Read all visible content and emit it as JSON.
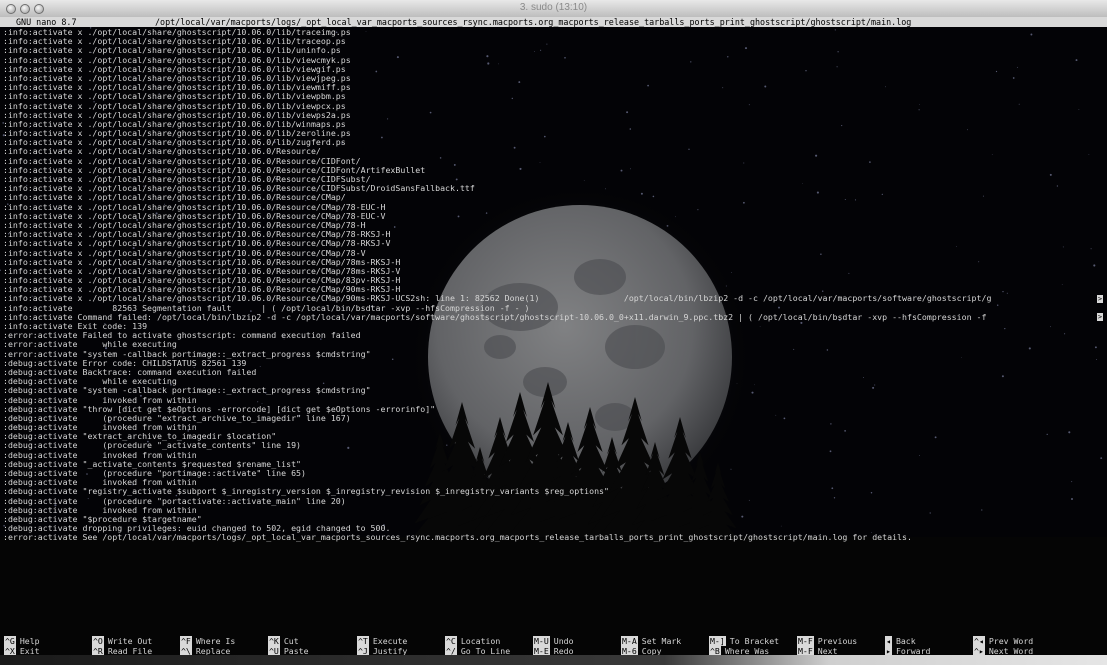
{
  "window": {
    "title": "3. sudo (13:10)"
  },
  "nano": {
    "version": "GNU nano 8.7",
    "file_path": "/opt/local/var/macports/logs/_opt_local_var_macports_sources_rsync.macports.org_macports_release_tarballs_ports_print_ghostscript/ghostscript/main.log"
  },
  "log_lines": [
    ":info:activate x ./opt/local/share/ghostscript/10.06.0/lib/traceimg.ps",
    ":info:activate x ./opt/local/share/ghostscript/10.06.0/lib/traceop.ps",
    ":info:activate x ./opt/local/share/ghostscript/10.06.0/lib/uninfo.ps",
    ":info:activate x ./opt/local/share/ghostscript/10.06.0/lib/viewcmyk.ps",
    ":info:activate x ./opt/local/share/ghostscript/10.06.0/lib/viewgif.ps",
    ":info:activate x ./opt/local/share/ghostscript/10.06.0/lib/viewjpeg.ps",
    ":info:activate x ./opt/local/share/ghostscript/10.06.0/lib/viewmiff.ps",
    ":info:activate x ./opt/local/share/ghostscript/10.06.0/lib/viewpbm.ps",
    ":info:activate x ./opt/local/share/ghostscript/10.06.0/lib/viewpcx.ps",
    ":info:activate x ./opt/local/share/ghostscript/10.06.0/lib/viewps2a.ps",
    ":info:activate x ./opt/local/share/ghostscript/10.06.0/lib/winmaps.ps",
    ":info:activate x ./opt/local/share/ghostscript/10.06.0/lib/zeroline.ps",
    ":info:activate x ./opt/local/share/ghostscript/10.06.0/lib/zugferd.ps",
    ":info:activate x ./opt/local/share/ghostscript/10.06.0/Resource/",
    ":info:activate x ./opt/local/share/ghostscript/10.06.0/Resource/CIDFont/",
    ":info:activate x ./opt/local/share/ghostscript/10.06.0/Resource/CIDFont/ArtifexBullet",
    ":info:activate x ./opt/local/share/ghostscript/10.06.0/Resource/CIDFSubst/",
    ":info:activate x ./opt/local/share/ghostscript/10.06.0/Resource/CIDFSubst/DroidSansFallback.ttf",
    ":info:activate x ./opt/local/share/ghostscript/10.06.0/Resource/CMap/",
    ":info:activate x ./opt/local/share/ghostscript/10.06.0/Resource/CMap/78-EUC-H",
    ":info:activate x ./opt/local/share/ghostscript/10.06.0/Resource/CMap/78-EUC-V",
    ":info:activate x ./opt/local/share/ghostscript/10.06.0/Resource/CMap/78-H",
    ":info:activate x ./opt/local/share/ghostscript/10.06.0/Resource/CMap/78-RKSJ-H",
    ":info:activate x ./opt/local/share/ghostscript/10.06.0/Resource/CMap/78-RKSJ-V",
    ":info:activate x ./opt/local/share/ghostscript/10.06.0/Resource/CMap/78-V",
    ":info:activate x ./opt/local/share/ghostscript/10.06.0/Resource/CMap/78ms-RKSJ-H",
    ":info:activate x ./opt/local/share/ghostscript/10.06.0/Resource/CMap/78ms-RKSJ-V",
    ":info:activate x ./opt/local/share/ghostscript/10.06.0/Resource/CMap/83pv-RKSJ-H",
    ":info:activate x ./opt/local/share/ghostscript/10.06.0/Resource/CMap/90ms-RKSJ-H",
    ":info:activate x ./opt/local/share/ghostscript/10.06.0/Resource/CMap/90ms-RKSJ-UCS2sh: line 1: 82562 Done(1)                 /opt/local/bin/lbzip2 -d -c /opt/local/var/macports/software/ghostscript/g",
    ":info:activate        82563 Segmentation fault      | ( /opt/local/bin/bsdtar -xvp --hfsCompression -f - )",
    ":info:activate Command failed: /opt/local/bin/lbzip2 -d -c /opt/local/var/macports/software/ghostscript/ghostscript-10.06.0_0+x11.darwin_9.ppc.tbz2 | ( /opt/local/bin/bsdtar -xvp --hfsCompression -f ",
    ":info:activate Exit code: 139",
    ":error:activate Failed to activate ghostscript: command execution failed",
    ":error:activate     while executing",
    ":error:activate \"system -callback portimage::_extract_progress $cmdstring\"",
    ":debug:activate Error code: CHILDSTATUS 82561 139",
    ":debug:activate Backtrace: command execution failed",
    ":debug:activate     while executing",
    ":debug:activate \"system -callback portimage::_extract_progress $cmdstring\"",
    ":debug:activate     invoked from within",
    ":debug:activate \"throw [dict get $eOptions -errorcode] [dict get $eOptions -errorinfo]\"",
    ":debug:activate     (procedure \"extract_archive_to_imagedir\" line 167)",
    ":debug:activate     invoked from within",
    ":debug:activate \"extract_archive_to_imagedir $location\"",
    ":debug:activate     (procedure \"_activate_contents\" line 19)",
    ":debug:activate     invoked from within",
    ":debug:activate \"_activate_contents $requested $rename_list\"",
    ":debug:activate     (procedure \"portimage::activate\" line 65)",
    ":debug:activate     invoked from within",
    ":debug:activate \"registry_activate $subport $_inregistry_version $_inregistry_revision $_inregistry_variants $reg_options\"",
    ":debug:activate     (procedure \"portactivate::activate_main\" line 20)",
    ":debug:activate     invoked from within",
    ":debug:activate \"$procedure $targetname\"",
    ":debug:activate dropping privileges: euid changed to 502, egid changed to 500.",
    ":error:activate See /opt/local/var/macports/logs/_opt_local_var_macports_sources_rsync.macports.org_macports_release_tarballs_ports_print_ghostscript/ghostscript/main.log for details."
  ],
  "overflow_marker": ">",
  "shortcuts": [
    {
      "key": "^G",
      "label": "Help"
    },
    {
      "key": "^X",
      "label": "Exit"
    },
    {
      "key": "^O",
      "label": "Write Out"
    },
    {
      "key": "^R",
      "label": "Read File"
    },
    {
      "key": "^F",
      "label": "Where Is"
    },
    {
      "key": "^\\",
      "label": "Replace"
    },
    {
      "key": "^K",
      "label": "Cut"
    },
    {
      "key": "^U",
      "label": "Paste"
    },
    {
      "key": "^T",
      "label": "Execute"
    },
    {
      "key": "^J",
      "label": "Justify"
    },
    {
      "key": "^C",
      "label": "Location"
    },
    {
      "key": "^/",
      "label": "Go To Line"
    },
    {
      "key": "M-U",
      "label": "Undo"
    },
    {
      "key": "M-E",
      "label": "Redo"
    },
    {
      "key": "M-A",
      "label": "Set Mark"
    },
    {
      "key": "M-6",
      "label": "Copy"
    },
    {
      "key": "M-]",
      "label": "To Bracket"
    },
    {
      "key": "^B",
      "label": "Where Was"
    },
    {
      "key": "M-F",
      "label": "Previous"
    },
    {
      "key": "M-F",
      "label": "Next"
    },
    {
      "key": "◂",
      "label": "Back"
    },
    {
      "key": "▸",
      "label": "Forward"
    },
    {
      "key": "^◂",
      "label": "Prev Word"
    },
    {
      "key": "^▸",
      "label": "Next Word"
    }
  ],
  "colors": {
    "terminal_bg": "#020204",
    "terminal_fg": "#d6d6d6",
    "header_bg": "#d9d9d9",
    "moon": "#6f7072"
  }
}
